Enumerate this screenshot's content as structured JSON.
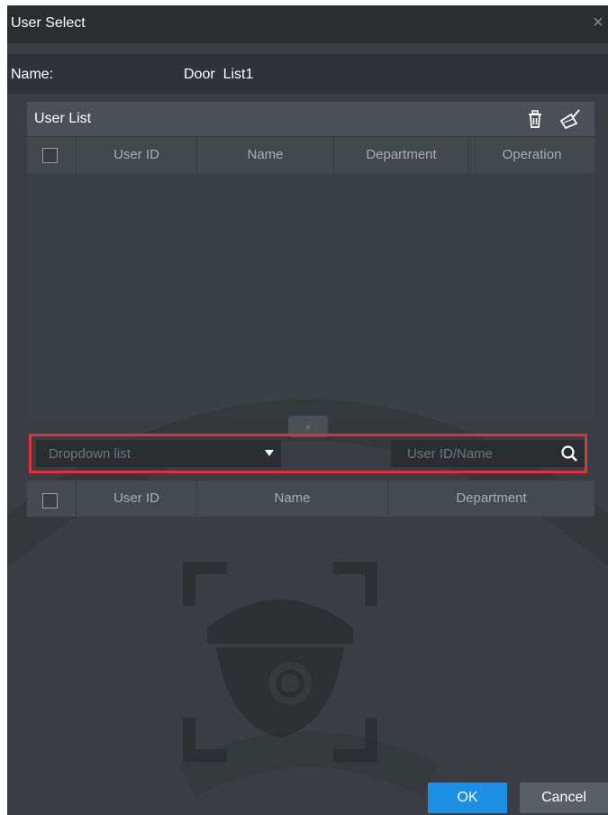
{
  "dialog": {
    "title": "User Select",
    "close_glyph": "×"
  },
  "name_row": {
    "label": "Name:",
    "value": "Door  List1"
  },
  "user_list": {
    "title": "User List",
    "delete_icon": "trash-icon",
    "clear_icon": "broom-icon",
    "columns": [
      "User ID",
      "Name",
      "Department",
      "Operation"
    ]
  },
  "filter": {
    "dropdown_label": "Dropdown list",
    "search_placeholder": "User ID/Name"
  },
  "available_list": {
    "columns": [
      "User ID",
      "Name",
      "Department"
    ]
  },
  "buttons": {
    "ok": "OK",
    "cancel": "Cancel"
  },
  "colors": {
    "accent": "#1a8fe4",
    "highlight": "#e0303b",
    "background": "#3a3e42"
  }
}
